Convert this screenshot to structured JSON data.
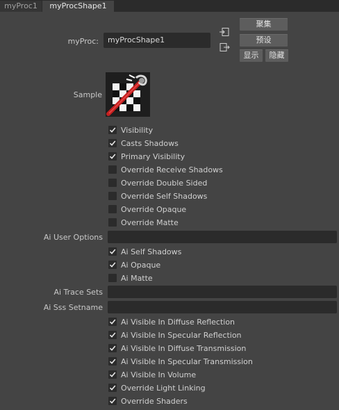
{
  "tabs": [
    {
      "label": "myProc1"
    },
    {
      "label": "myProcShape1"
    }
  ],
  "proc": {
    "label": "myProc:",
    "value": "myProcShape1"
  },
  "buttons": {
    "focus": "聚集",
    "preset": "预设",
    "show": "显示",
    "hide": "隐藏"
  },
  "sample": {
    "label": "Sample"
  },
  "checkboxes_a": [
    {
      "label": "Visibility",
      "checked": true
    },
    {
      "label": "Casts Shadows",
      "checked": true
    },
    {
      "label": "Primary Visibility",
      "checked": true
    },
    {
      "label": "Override Receive Shadows",
      "checked": false
    },
    {
      "label": "Override Double Sided",
      "checked": false
    },
    {
      "label": "Override Self Shadows",
      "checked": false
    },
    {
      "label": "Override Opaque",
      "checked": false
    },
    {
      "label": "Override Matte",
      "checked": false
    }
  ],
  "user_options": {
    "label": "Ai User Options",
    "value": ""
  },
  "checkboxes_b": [
    {
      "label": "Ai Self Shadows",
      "checked": true
    },
    {
      "label": "Ai Opaque",
      "checked": true
    },
    {
      "label": "Ai Matte",
      "checked": false
    }
  ],
  "trace_sets": {
    "label": "Ai Trace Sets",
    "value": ""
  },
  "sss_setname": {
    "label": "Ai Sss Setname",
    "value": ""
  },
  "checkboxes_c": [
    {
      "label": "Ai Visible In Diffuse Reflection",
      "checked": true
    },
    {
      "label": "Ai Visible In Specular Reflection",
      "checked": true
    },
    {
      "label": "Ai Visible In Diffuse Transmission",
      "checked": true
    },
    {
      "label": "Ai Visible In Specular Transmission",
      "checked": true
    },
    {
      "label": "Ai Visible In Volume",
      "checked": true
    },
    {
      "label": "Override Light Linking",
      "checked": true
    },
    {
      "label": "Override Shaders",
      "checked": true
    }
  ],
  "icons": {
    "input_connection": "input-connection-icon",
    "output_connection": "output-connection-icon",
    "sample": "procedural-sample-icon"
  }
}
